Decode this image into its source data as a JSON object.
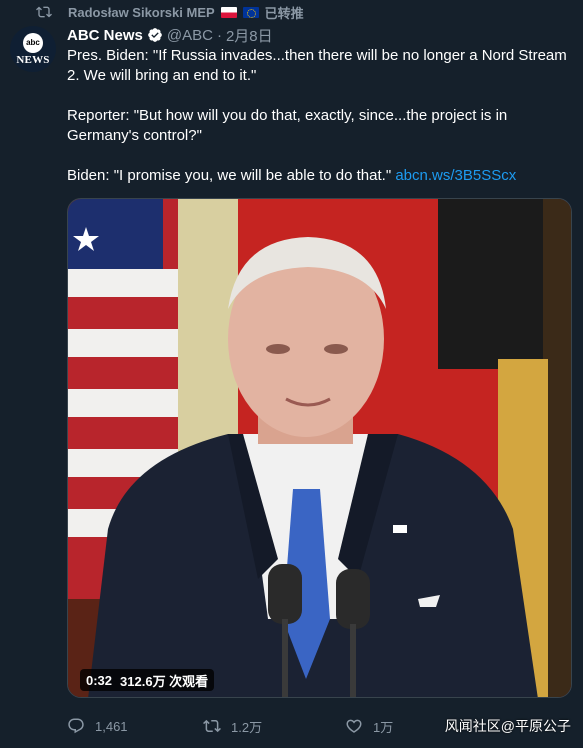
{
  "retweet": {
    "retweeter": "Radosław Sikorski MEP",
    "label": "已转推",
    "flags": [
      "poland-flag",
      "eu-flag"
    ]
  },
  "author": {
    "avatar_top": "abc",
    "avatar_bottom": "NEWS",
    "name": "ABC News",
    "handle": "@ABC",
    "separator": "·",
    "date": "2月8日",
    "verified": true
  },
  "tweet": {
    "para1": "Pres. Biden: \"If Russia invades...then there will be no longer a Nord Stream 2. We will bring an end to it.\"",
    "para2": "Reporter: \"But how will you do that, exactly, since...the project is in Germany's control?\"",
    "para3": "Biden: \"I promise you, we will be able to do that.\"",
    "link": "abcn.ws/3B5SScx"
  },
  "video": {
    "duration": "0:32",
    "views": "312.6万 次观看"
  },
  "actions": {
    "replies": "1,461",
    "retweets": "1.2万",
    "likes": "1万"
  },
  "watermark": "风闻社区@平原公子",
  "colors": {
    "background": "#15202b",
    "secondary_text": "#8b98a5",
    "link": "#1d9bf0"
  }
}
